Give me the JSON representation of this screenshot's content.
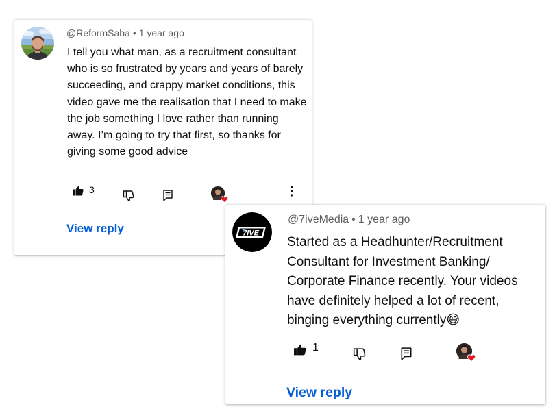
{
  "comments": [
    {
      "author": "@ReformSaba",
      "separator": "•",
      "time": "1 year ago",
      "text": "I tell you what man, as a recruitment consultant who is so frustrated by years and years of barely succeeding, and crappy market conditions, this video gave me the realisation that I need to make the job something I love rather than running away. I’m going to try that first, so thanks for giving some good advice",
      "likes": "3",
      "view_reply": "View reply",
      "avatar_icon": "user-photo-avatar",
      "creator_heart_icon": "creator-heart-icon",
      "more_icon": "more-vertical-icon"
    },
    {
      "author": "@7iveMedia",
      "separator": "•",
      "time": "1 year ago",
      "text": "Started as a Headhunter/Recruitment Consultant for Investment Banking/ Corporate Finance recently. Your videos have definitely helped a lot of recent, binging everything currently",
      "emoji": "😅",
      "likes": "1",
      "view_reply": "View reply",
      "avatar_text": "7IVE",
      "avatar_icon": "7ive-logo-avatar",
      "creator_heart_icon": "creator-heart-icon"
    }
  ],
  "colors": {
    "link": "#065fd4",
    "meta": "#606060",
    "text": "#0f0f0f",
    "heart": "#e01b24"
  }
}
